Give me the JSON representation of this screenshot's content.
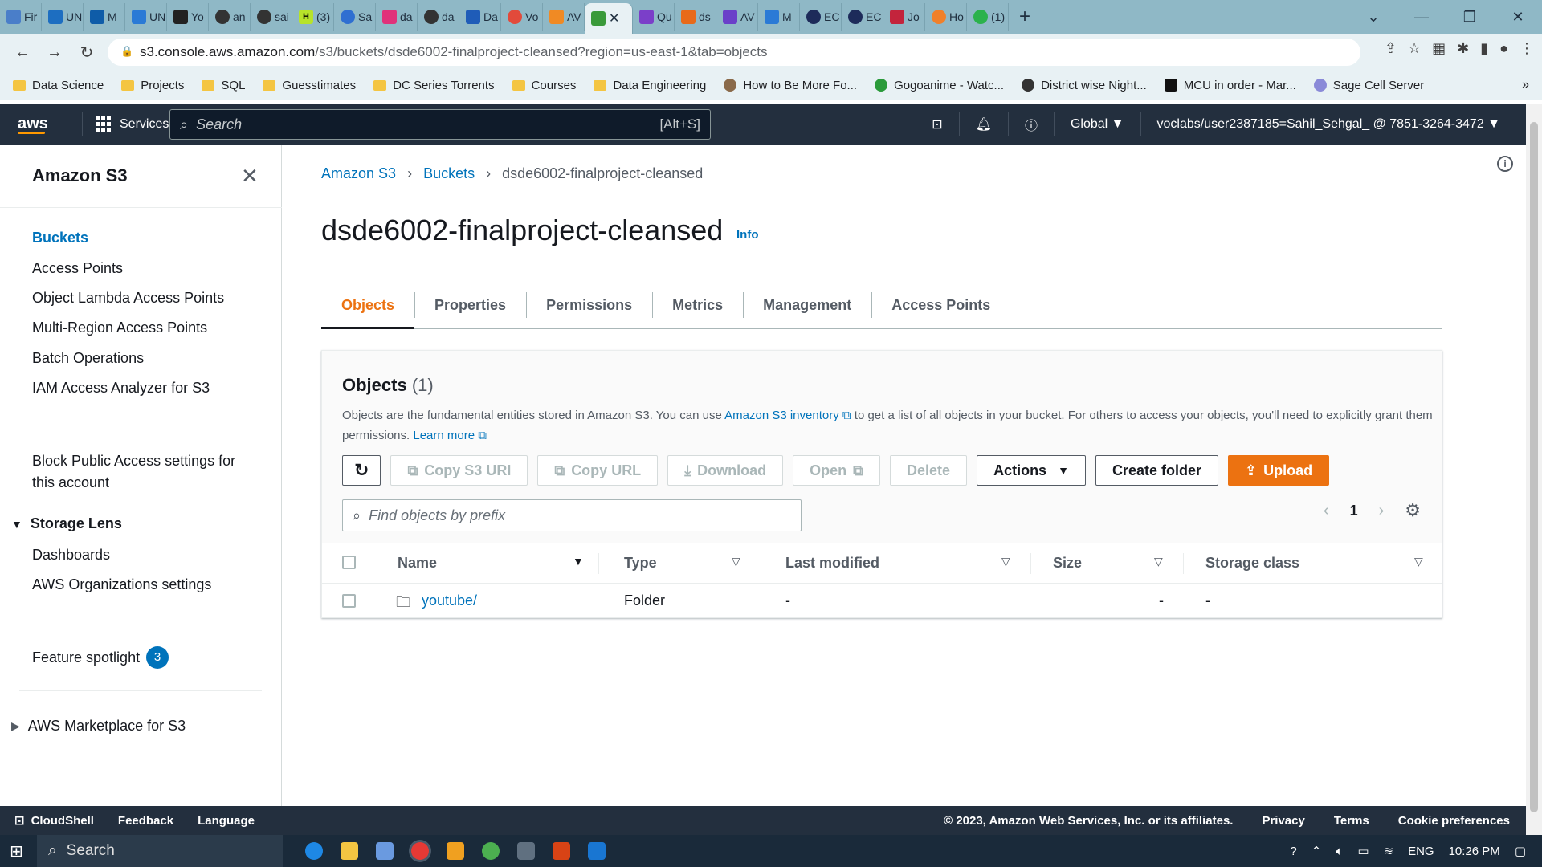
{
  "browser": {
    "tabs": [
      "Fir",
      "UN",
      "M",
      "UN",
      "Yo",
      "an",
      "sai",
      "(3)",
      "Sa",
      "da",
      "da",
      "Da",
      "Vo",
      "AV",
      "",
      "Qu",
      "ds",
      "AV",
      "M",
      "EC",
      "EC",
      "Jo",
      "Ho",
      "(1)"
    ],
    "url_host": "s3.console.aws.amazon.com",
    "url_path": "/s3/buckets/dsde6002-finalproject-cleansed?region=us-east-1&tab=objects",
    "bookmarks": [
      "Data Science",
      "Projects",
      "SQL",
      "Guesstimates",
      "DC Series Torrents",
      "Courses",
      "Data Engineering",
      "How to Be More Fo...",
      "Gogoanime - Watc...",
      "District wise Night...",
      "MCU in order - Mar...",
      "Sage Cell Server"
    ]
  },
  "awsnav": {
    "logo": "aws",
    "services": "Services",
    "search_placeholder": "Search",
    "search_shortcut": "[Alt+S]",
    "region": "Global ▼",
    "account": "voclabs/user2387185=Sahil_Sehgal_ @ 7851-3264-3472 ▼"
  },
  "sidebar": {
    "title": "Amazon S3",
    "items": [
      "Buckets",
      "Access Points",
      "Object Lambda Access Points",
      "Multi-Region Access Points",
      "Batch Operations",
      "IAM Access Analyzer for S3"
    ],
    "block_public_line1": "Block Public Access settings for",
    "block_public_line2": "this account",
    "storage_lens": "Storage Lens",
    "storage_lens_items": [
      "Dashboards",
      "AWS Organizations settings"
    ],
    "feature_spotlight": "Feature spotlight",
    "feature_badge": "3",
    "marketplace": "AWS Marketplace for S3"
  },
  "main": {
    "breadcrumb": [
      "Amazon S3",
      "Buckets",
      "dsde6002-finalproject-cleansed"
    ],
    "title": "dsde6002-finalproject-cleansed",
    "info": "Info",
    "tabs": [
      "Objects",
      "Properties",
      "Permissions",
      "Metrics",
      "Management",
      "Access Points"
    ],
    "objects_title": "Objects",
    "objects_count": "(1)",
    "desc_1": "Objects are the fundamental entities stored in Amazon S3. You can use ",
    "desc_link1": "Amazon S3 inventory",
    "desc_2": " to get a list of all objects in your bucket. For others to access your objects, you'll need to explicitly grant them permissions. ",
    "desc_link2": "Learn more",
    "buttons": {
      "copy_s3_uri": "Copy S3 URI",
      "copy_url": "Copy URL",
      "download": "Download",
      "open": "Open",
      "delete": "Delete",
      "actions": "Actions",
      "create_folder": "Create folder",
      "upload": "Upload"
    },
    "find_placeholder": "Find objects by prefix",
    "page_number": "1",
    "columns": [
      "Name",
      "Type",
      "Last modified",
      "Size",
      "Storage class"
    ],
    "rows": [
      {
        "name": "youtube/",
        "type": "Folder",
        "last_modified": "-",
        "size": "-",
        "storage_class": "-"
      }
    ]
  },
  "footer": {
    "cloudshell": "CloudShell",
    "feedback": "Feedback",
    "language": "Language",
    "copyright": "© 2023, Amazon Web Services, Inc. or its affiliates.",
    "privacy": "Privacy",
    "terms": "Terms",
    "cookie": "Cookie preferences"
  },
  "taskbar": {
    "search": "Search",
    "lang": "ENG",
    "time": "10:26 PM"
  },
  "colors": {
    "aws_nav": "#232f3e",
    "link": "#0073bb",
    "accent": "#ec7211"
  }
}
